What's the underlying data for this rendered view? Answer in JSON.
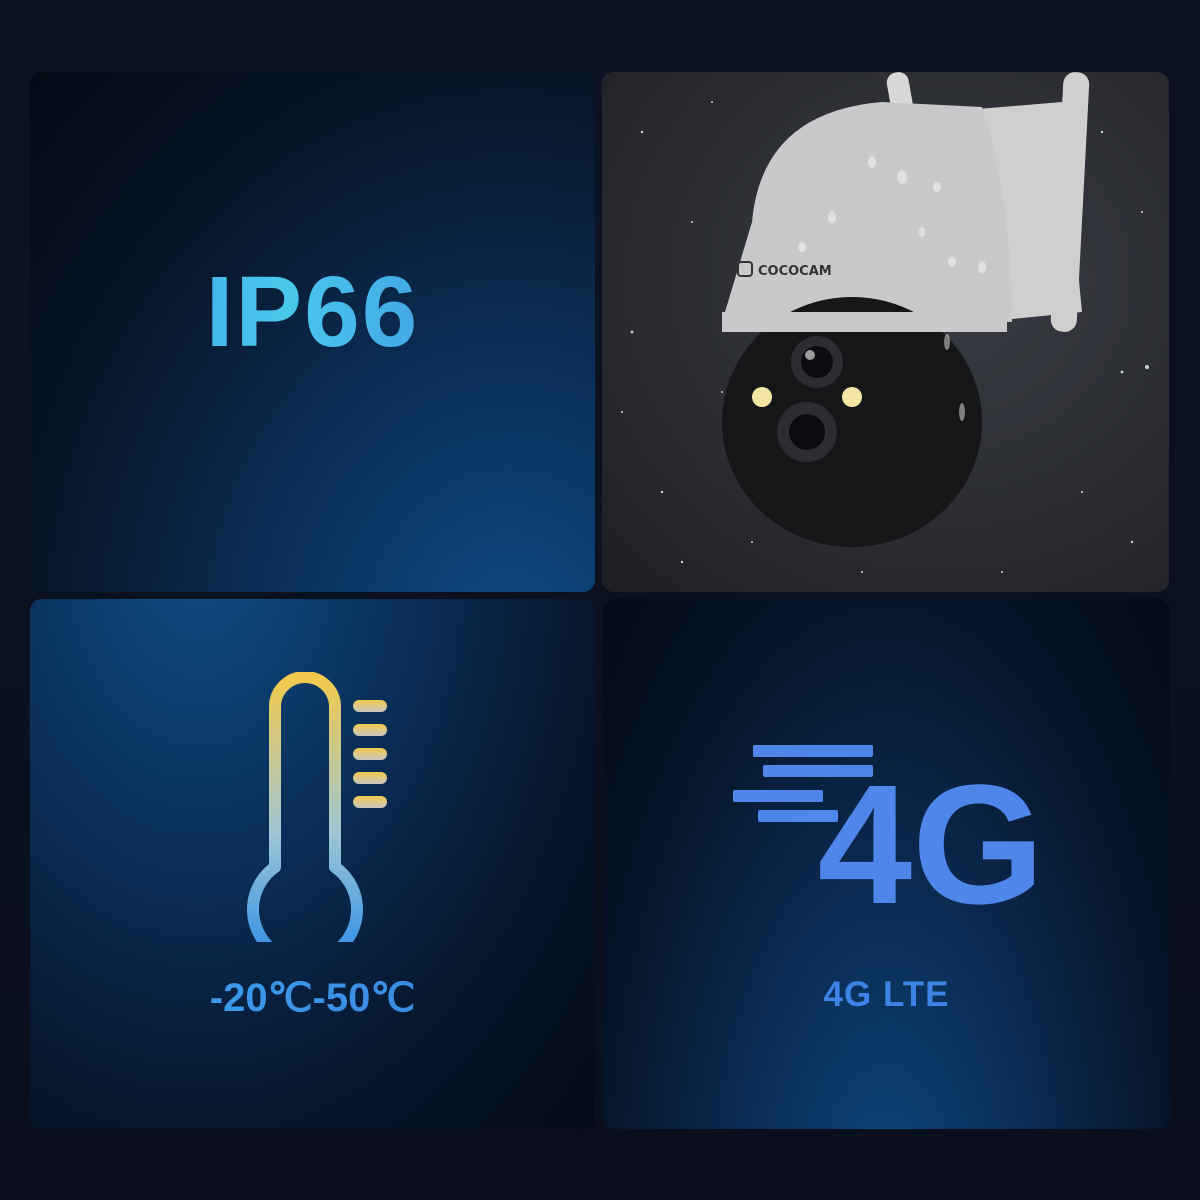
{
  "features": {
    "waterproof": {
      "label": "IP66"
    },
    "temperature": {
      "label": "-20℃-50℃",
      "icon": "thermometer-icon"
    },
    "network": {
      "label": "4G LTE",
      "icon_text": "4G",
      "icon": "4g-speed-icon"
    }
  },
  "camera": {
    "brand": "COCOCAM"
  },
  "colors": {
    "accent_blue": "#3c7fe0",
    "accent_cyan": "#49c8ec",
    "accent_yellow": "#f2c94c"
  }
}
